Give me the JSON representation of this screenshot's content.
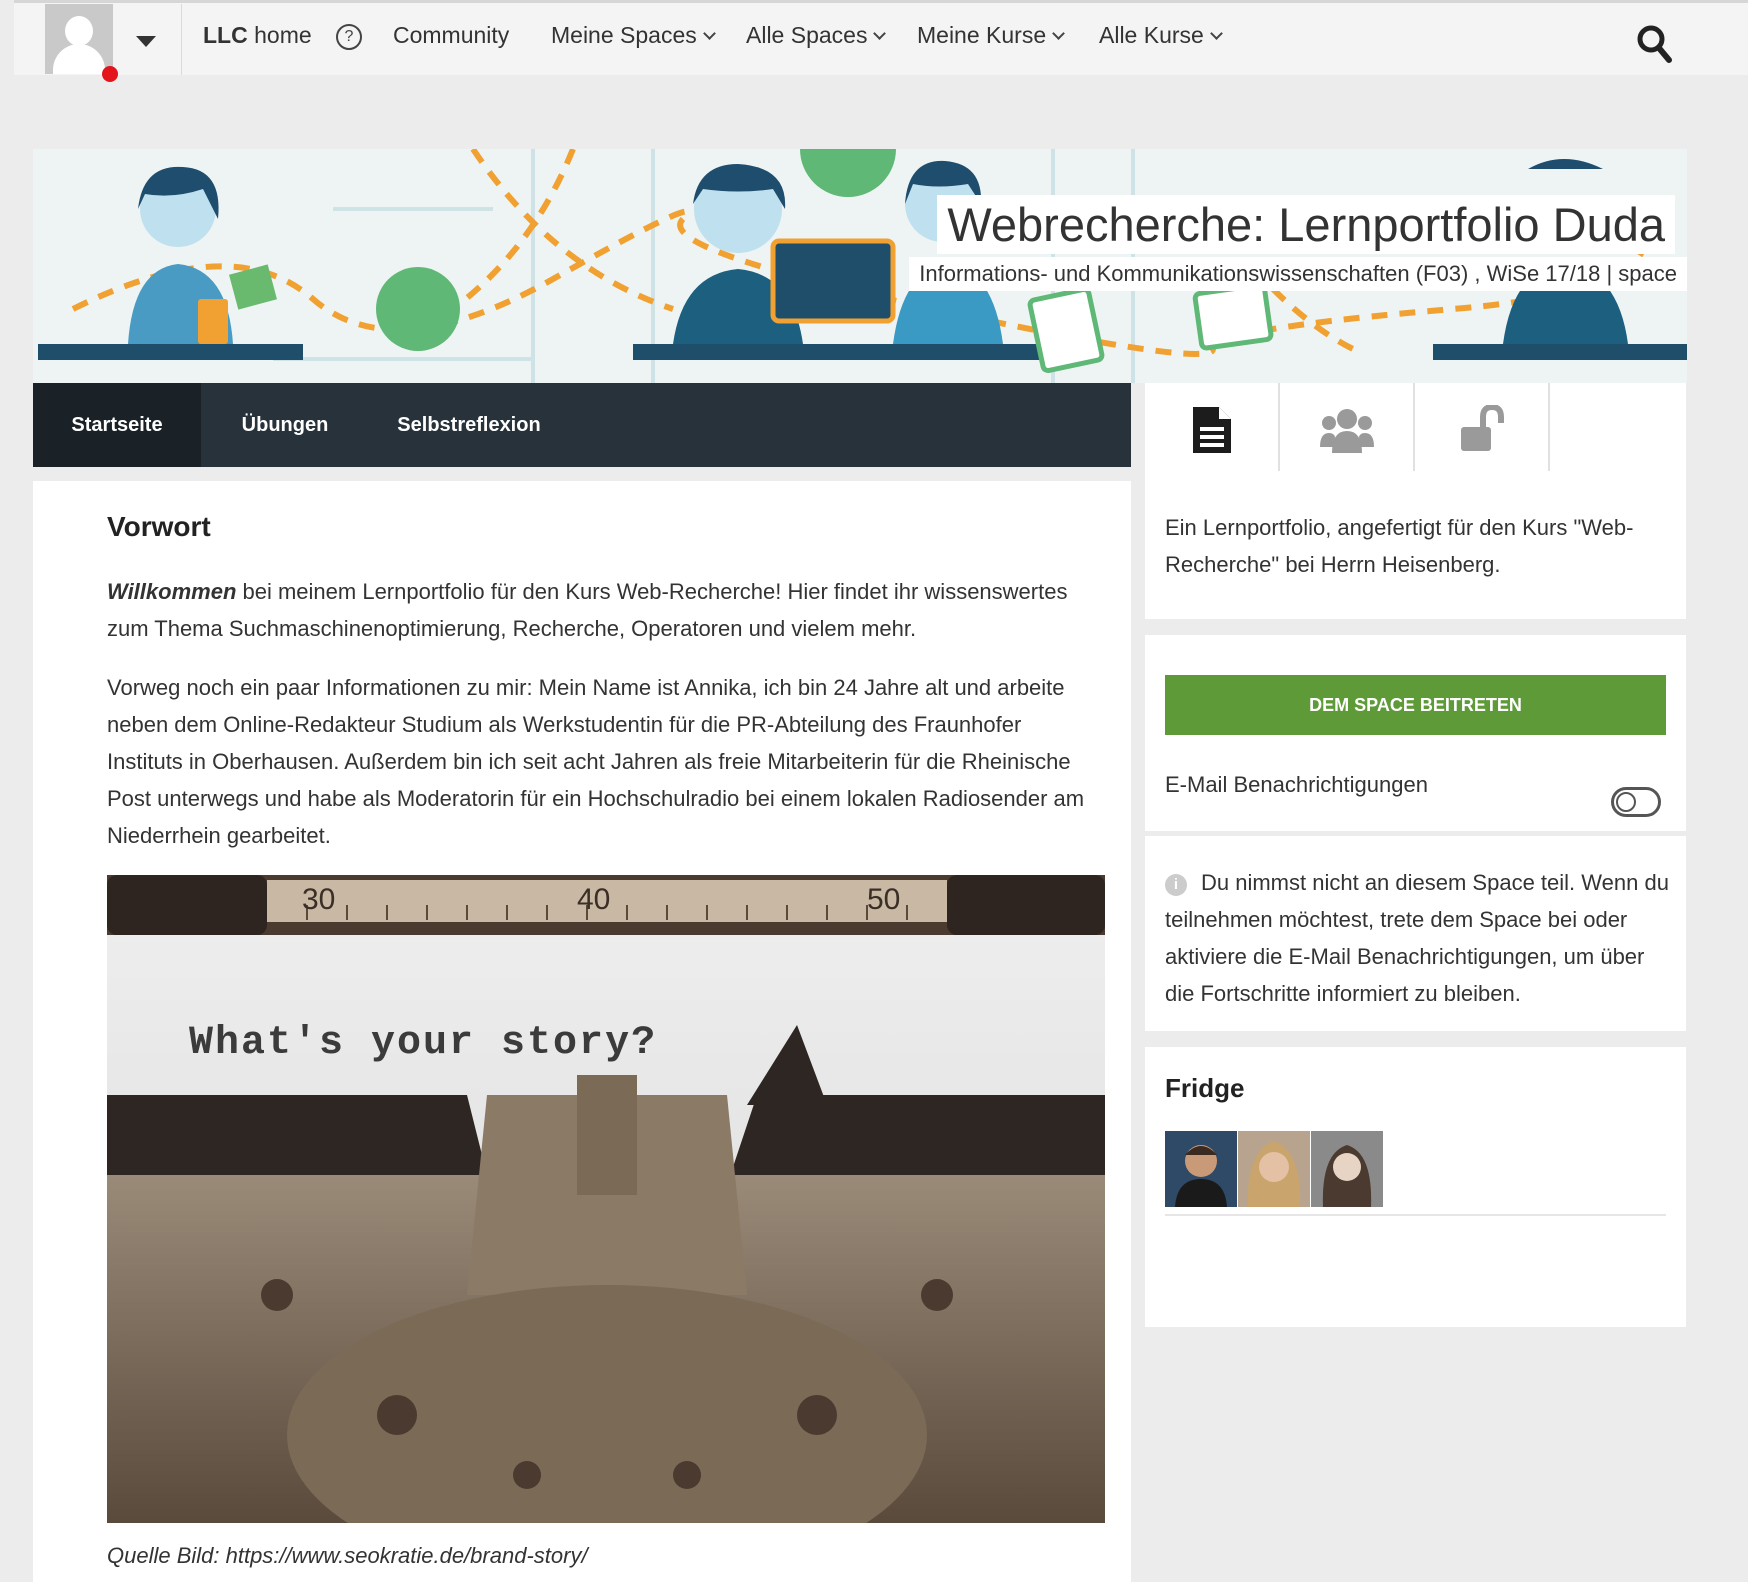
{
  "nav": {
    "home_bold": "LLC",
    "home_rest": "home",
    "community": "Community",
    "my_spaces": "Meine Spaces",
    "all_spaces": "Alle Spaces",
    "my_courses": "Meine Kurse",
    "all_courses": "Alle Kurse",
    "help_glyph": "?"
  },
  "banner": {
    "title": "Webrecherche: Lernportfolio Duda",
    "subtitle": "Informations- und Kommunikationswissenschaften (F03) , WiSe 17/18 | space"
  },
  "tabs": [
    {
      "label": "Startseite",
      "active": true
    },
    {
      "label": "Übungen",
      "active": false
    },
    {
      "label": "Selbstreflexion",
      "active": false
    }
  ],
  "main": {
    "heading": "Vorwort",
    "p1_bold": "Willkommen",
    "p1_rest": " bei meinem Lernportfolio für den Kurs Web-Recherche! Hier findet ihr wissenswertes zum Thema Suchmaschinenoptimierung, Recherche, Operatoren und vielem mehr.",
    "p2": "Vorweg noch ein paar Informationen zu mir: Mein Name ist Annika, ich bin 24 Jahre alt und arbeite neben dem Online-Redakteur Studium als Werkstudentin für die PR-Abteilung des Fraunhofer Instituts in Oberhausen. Außerdem bin ich seit acht Jahren als freie Mitarbeiterin für die Rheinische Post unterwegs und habe als Moderatorin für ein Hochschulradio bei einem lokalen Radiosender am Niederrhein gearbeitet.",
    "image_text": "What's your story?",
    "ruler_marks": [
      "30",
      "40",
      "50"
    ],
    "caption": "Quelle Bild: https://www.seokratie.de/brand-story/"
  },
  "sidebar": {
    "about": "Ein Lernportfolio, angefertigt für den Kurs \"Web-Recherche\" bei Herrn Heisenberg.",
    "join_button": "DEM SPACE BEITRETEN",
    "email_label": "E-Mail Benachrichtigungen",
    "email_enabled": false,
    "info_glyph": "i",
    "info_text": "Du nimmst nicht an diesem Space teil. Wenn du teilnehmen möchtest, trete dem Space bei oder aktiviere die E-Mail Benachrichtigungen, um über die Fortschritte informiert zu bleiben.",
    "fridge_title": "Fridge"
  },
  "colors": {
    "accent_green": "#5f9a38",
    "tabbar": "#27323a",
    "notification_dot": "#e3141b"
  },
  "icons": [
    "user-avatar-icon",
    "caret-down-icon",
    "help-icon",
    "search-icon",
    "document-icon",
    "users-icon",
    "unlock-icon",
    "info-icon"
  ]
}
